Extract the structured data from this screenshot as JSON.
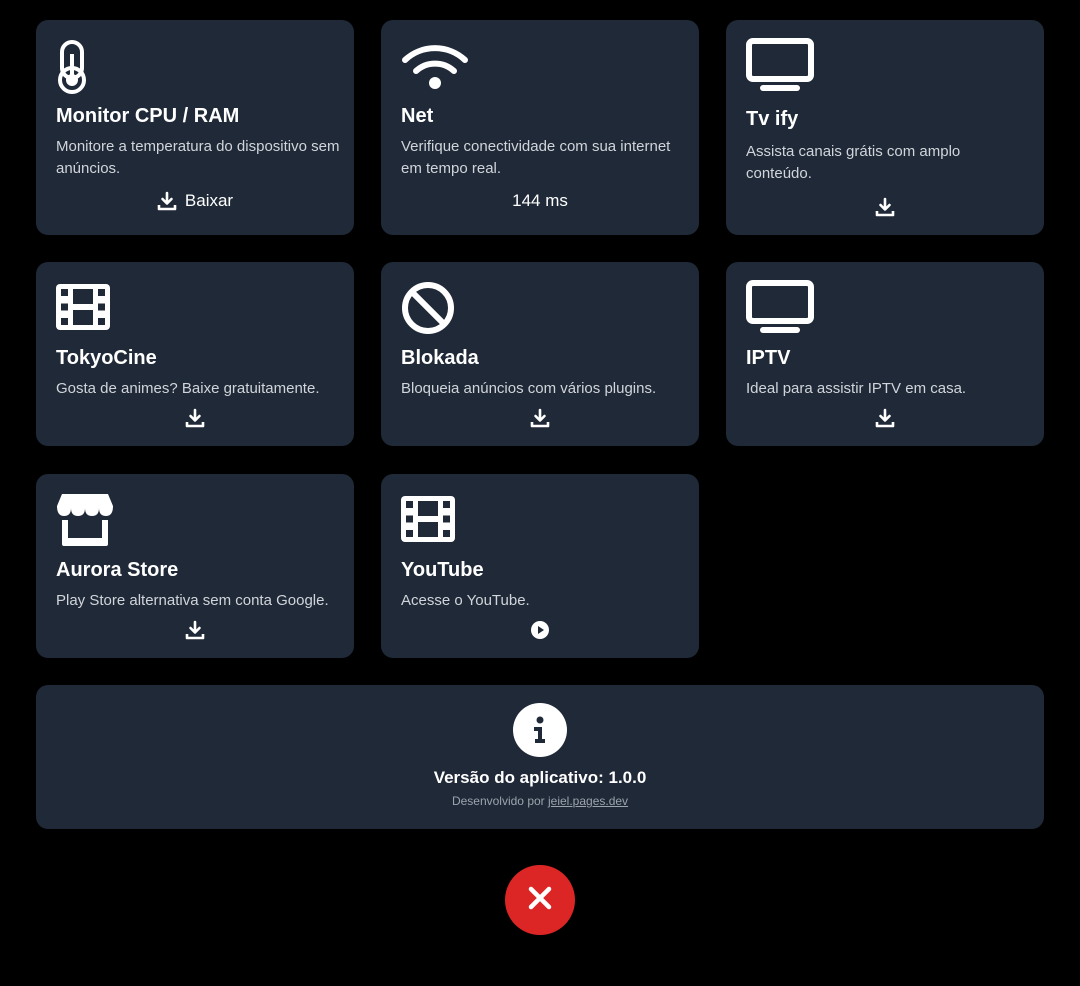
{
  "cards": [
    {
      "icon": "thermometer-icon",
      "title": "Monitor CPU / RAM",
      "description": "Monitore a temperatura do dispositivo sem anúncios.",
      "action_icon": "download-icon",
      "action_label": "Baixar"
    },
    {
      "icon": "wifi-icon",
      "title": "Net",
      "description": "Verifique conectividade com sua internet em tempo real.",
      "action_label": "144 ms"
    },
    {
      "icon": "tv-icon",
      "title": "Tv ify",
      "description": "Assista canais grátis com amplo conteúdo.",
      "action_icon": "download-icon"
    },
    {
      "icon": "film-icon",
      "title": "TokyoCine",
      "description": "Gosta de animes? Baixe gratuitamente.",
      "action_icon": "download-icon"
    },
    {
      "icon": "ban-icon",
      "title": "Blokada",
      "description": "Bloqueia anúncios com vários plugins.",
      "action_icon": "download-icon"
    },
    {
      "icon": "tv-icon",
      "title": "IPTV",
      "description": "Ideal para assistir IPTV em casa.",
      "action_icon": "download-icon"
    },
    {
      "icon": "store-icon",
      "title": "Aurora Store",
      "description": "Play Store alternativa sem conta Google.",
      "action_icon": "download-icon"
    },
    {
      "icon": "film-icon",
      "title": "YouTube",
      "description": "Acesse o YouTube.",
      "action_icon": "play-circle-icon"
    }
  ],
  "info": {
    "icon": "info-icon",
    "version_text": "Versão do aplicativo: 1.0.0",
    "developed_by": "Desenvolvido por",
    "developer_link": "jeiel.pages.dev"
  },
  "close_button": {
    "icon": "close-icon"
  },
  "colors": {
    "background": "#000000",
    "card": "#1f2937",
    "text": "#ffffff",
    "muted_text": "#d1d5db",
    "close_button": "#dc2626"
  }
}
